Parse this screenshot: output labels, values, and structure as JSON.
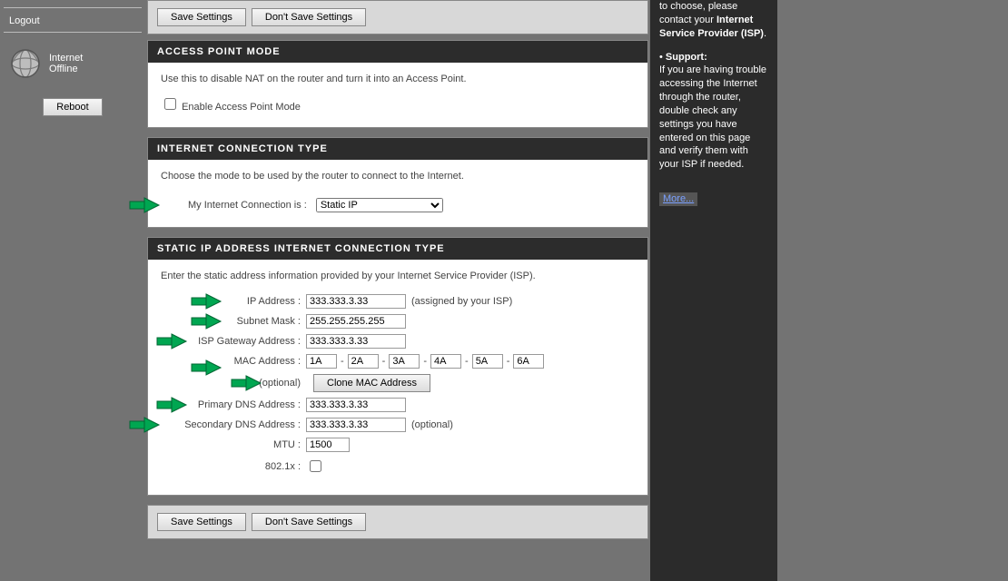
{
  "left": {
    "logout": "Logout",
    "status1": "Internet",
    "status2": "Offline",
    "reboot": "Reboot"
  },
  "toolbar": {
    "save": "Save Settings",
    "dont_save": "Don't Save Settings"
  },
  "apm": {
    "header": "ACCESS POINT MODE",
    "desc": "Use this to disable NAT on the router and turn it into an Access Point.",
    "checkbox_label": "Enable Access Point Mode"
  },
  "ict": {
    "header": "INTERNET CONNECTION TYPE",
    "desc": "Choose the mode to be used by the router to connect to the Internet.",
    "label": "My Internet Connection is :",
    "value": "Static IP"
  },
  "staticip": {
    "header": "STATIC IP ADDRESS INTERNET CONNECTION TYPE",
    "desc": "Enter the static address information provided by your Internet Service Provider (ISP).",
    "ip_label": "IP Address :",
    "ip_value": "333.333.3.33",
    "ip_note": "(assigned by your ISP)",
    "subnet_label": "Subnet Mask :",
    "subnet_value": "255.255.255.255",
    "gateway_label": "ISP Gateway Address :",
    "gateway_value": "333.333.3.33",
    "mac_label": "MAC Address :",
    "mac": {
      "0": "1A",
      "1": "2A",
      "2": "3A",
      "3": "4A",
      "4": "5A",
      "5": "6A"
    },
    "mac_optional": "(optional)",
    "clone": "Clone MAC Address",
    "pdns_label": "Primary DNS Address :",
    "pdns_value": "333.333.3.33",
    "sdns_label": "Secondary DNS Address :",
    "sdns_value": "333.333.3.33",
    "sdns_note": "(optional)",
    "mtu_label": "MTU :",
    "mtu_value": "1500",
    "dot1x_label": "802.1x :"
  },
  "help": {
    "p1_a": "to choose, please contact your ",
    "p1_b": "Internet Service Provider (ISP)",
    "p1_c": ".",
    "bullet": "•  ",
    "support": "Support:",
    "p2": "If you are having trouble accessing the Internet through the router, double check any settings you have entered on this page and verify them with your ISP if needed.",
    "more": "More..."
  }
}
